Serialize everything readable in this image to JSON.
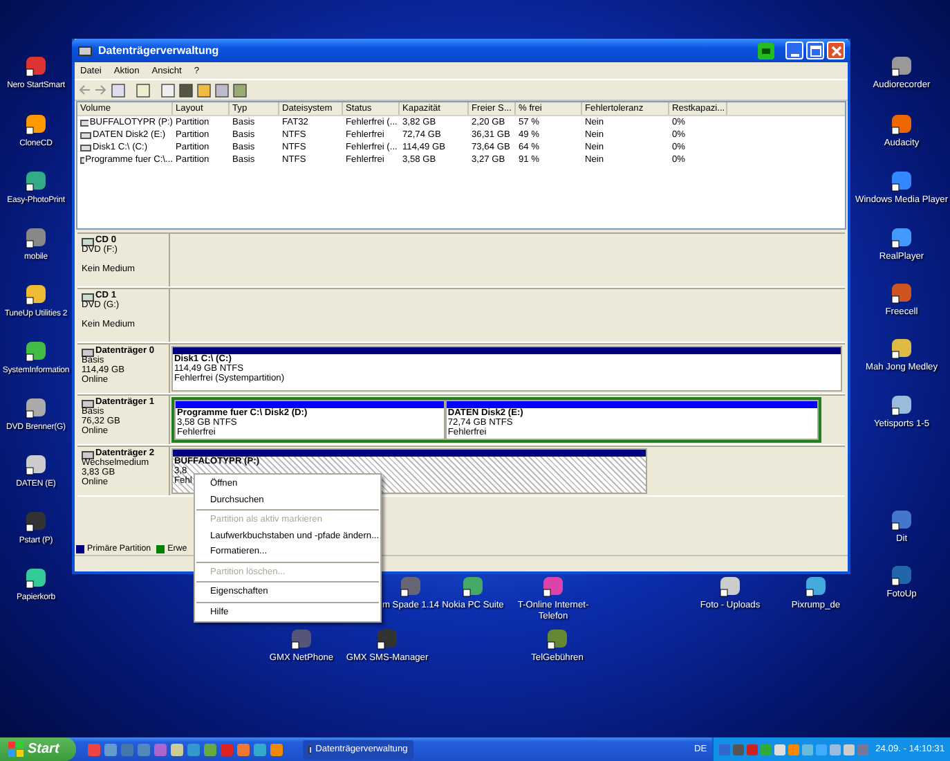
{
  "window": {
    "title": "Datenträgerverwaltung"
  },
  "menu": [
    "Datei",
    "Aktion",
    "Ansicht",
    "?"
  ],
  "volume_table": {
    "columns": [
      "Volume",
      "Layout",
      "Typ",
      "Dateisystem",
      "Status",
      "Kapazität",
      "Freier S...",
      "% frei",
      "Fehlertoleranz",
      "Restkapazi..."
    ],
    "rows": [
      [
        "BUFFALOTYPR (P:)",
        "Partition",
        "Basis",
        "FAT32",
        "Fehlerfrei (...",
        "3,82 GB",
        "2,20 GB",
        "57 %",
        "Nein",
        "0%"
      ],
      [
        "DATEN Disk2 (E:)",
        "Partition",
        "Basis",
        "NTFS",
        "Fehlerfrei",
        "72,74 GB",
        "36,31 GB",
        "49 %",
        "Nein",
        "0%"
      ],
      [
        "Disk1 C:\\ (C:)",
        "Partition",
        "Basis",
        "NTFS",
        "Fehlerfrei (...",
        "114,49 GB",
        "73,64 GB",
        "64 %",
        "Nein",
        "0%"
      ],
      [
        "Programme fuer C:\\...",
        "Partition",
        "Basis",
        "NTFS",
        "Fehlerfrei",
        "3,58 GB",
        "3,27 GB",
        "91 %",
        "Nein",
        "0%"
      ]
    ]
  },
  "disks": [
    {
      "kind": "cd",
      "name": "CD 0",
      "type": "DVD (F:)",
      "status": "Kein Medium"
    },
    {
      "kind": "cd",
      "name": "CD 1",
      "type": "DVD (G:)",
      "status": "Kein Medium"
    },
    {
      "kind": "disk",
      "name": "Datenträger 0",
      "type": "Basis",
      "size": "114,49 GB",
      "status": "Online",
      "extended": false,
      "partitions": [
        {
          "kind": "primary",
          "selected": false,
          "name": "Disk1 C:\\  (C:)",
          "size": "114,49 GB NTFS",
          "status": "Fehlerfrei (Systempartition)"
        }
      ]
    },
    {
      "kind": "disk",
      "name": "Datenträger 1",
      "type": "Basis",
      "size": "76,32 GB",
      "status": "Online",
      "extended": true,
      "partitions": [
        {
          "kind": "logical",
          "selected": false,
          "name": "Programme fuer C:\\ Disk2  (D:)",
          "size": "3,58 GB NTFS",
          "status": "Fehlerfrei"
        },
        {
          "kind": "logical",
          "selected": false,
          "name": "DATEN Disk2  (E:)",
          "size": "72,74 GB NTFS",
          "status": "Fehlerfrei"
        }
      ]
    },
    {
      "kind": "disk",
      "name": "Datenträger 2",
      "type": "Wechselmedium",
      "size": "3,83 GB",
      "status": "Online",
      "extended": false,
      "partitions": [
        {
          "kind": "primary",
          "selected": true,
          "name": "BUFFALOTYPR  (P:)",
          "size": "3,8",
          "status": "Fehl"
        }
      ]
    }
  ],
  "legend": [
    {
      "label": "Primäre Partition",
      "color": "#000080"
    },
    {
      "label": "Erwe",
      "color": "#008000"
    }
  ],
  "context_menu": [
    {
      "kind": "item",
      "label": "Öffnen",
      "disabled": false
    },
    {
      "kind": "item",
      "label": "Durchsuchen",
      "disabled": false
    },
    {
      "kind": "separator"
    },
    {
      "kind": "item",
      "label": "Partition als aktiv markieren",
      "disabled": true
    },
    {
      "kind": "item",
      "label": "Laufwerkbuchstaben und -pfade ändern...",
      "disabled": false
    },
    {
      "kind": "item",
      "label": "Formatieren...",
      "disabled": false
    },
    {
      "kind": "separator"
    },
    {
      "kind": "item",
      "label": "Partition löschen...",
      "disabled": true
    },
    {
      "kind": "separator"
    },
    {
      "kind": "item",
      "label": "Eigenschaften",
      "disabled": false
    },
    {
      "kind": "separator"
    },
    {
      "kind": "item",
      "label": "Hilfe",
      "disabled": false
    }
  ],
  "desktop_icons_left": [
    "Nero StartSmart",
    "CloneCD",
    "Easy-PhotoPrint",
    "mobile",
    "TuneUp Utilities 2",
    "SystemInformation",
    "DVD Brenner(G)",
    "DATEN (E)",
    "Pstart (P)",
    "Papierkorb"
  ],
  "desktop_icons_right": [
    "Audiorecorder",
    "Audacity",
    "Windows Media Player",
    "RealPlayer",
    "Freecell",
    "Mah Jong Medley",
    "Yetisports 1-5",
    "Dit",
    "FotoUp"
  ],
  "desktop_icons_bottom": [
    "m Spade 1.14",
    "Nokia PC Suite",
    "T-Online Internet-Telefon",
    "Foto - Uploads",
    "Pixrump_de",
    "GMX NetPhone",
    "GMX SMS-Manager",
    "TelGebühren"
  ],
  "taskbar": {
    "start": "Start",
    "task": "Datenträgerverwaltung",
    "language": "DE",
    "clock": "24.09. - 14:10:31"
  }
}
